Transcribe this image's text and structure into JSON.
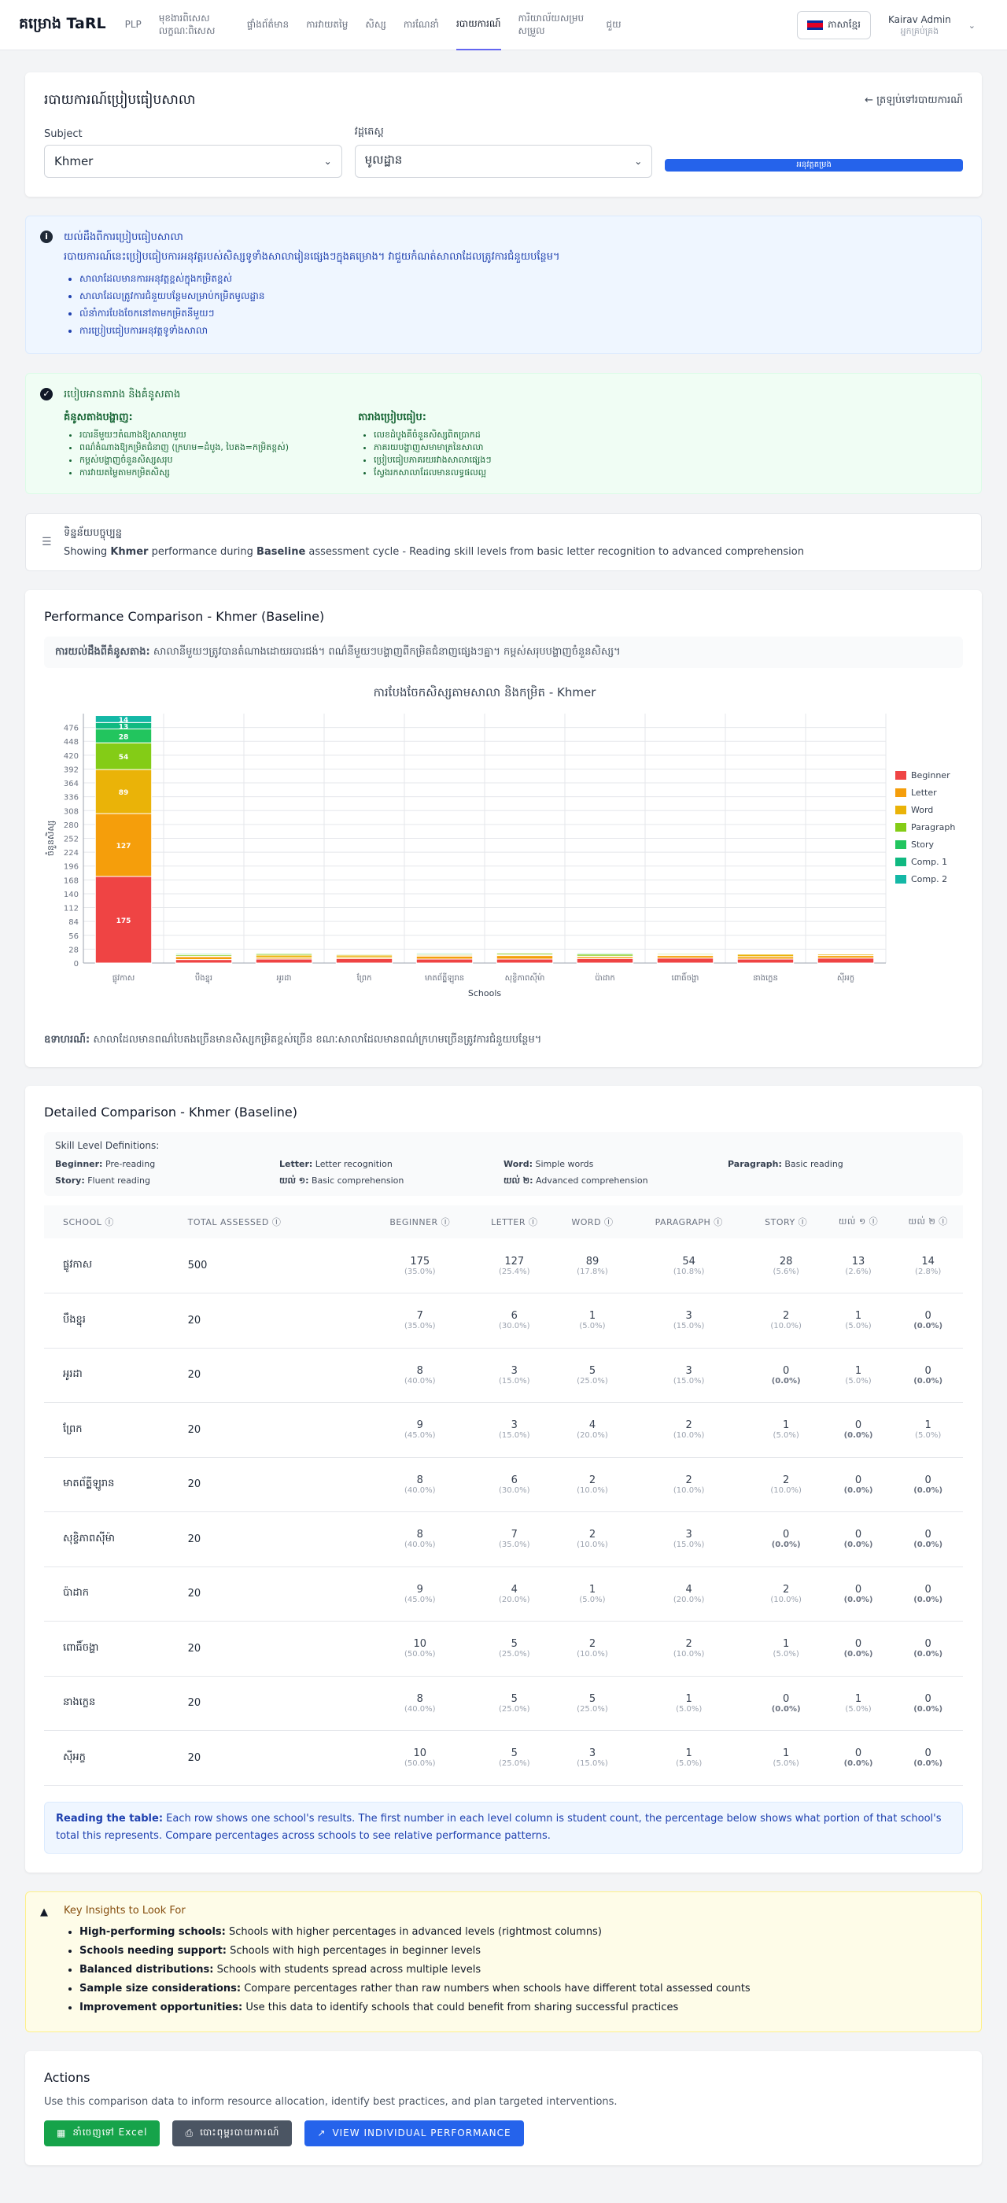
{
  "nav": {
    "brand": "គម្រោង TaRL",
    "links": [
      "PLP",
      "មុខងារពិសេស លក្ខណៈពិសេស",
      "ផ្ទាំងព័ត៌មាន",
      "ការវាយតម្លៃ",
      "សិស្ស",
      "ការណែនាំ",
      "របាយការណ៍",
      "ការិយាល័យសម្របសម្រួល",
      "ជួយ"
    ],
    "active_index": 6,
    "language": "ភាសាខ្មែរ",
    "user_name": "Kairav Admin",
    "user_role": "អ្នកគ្រប់គ្រង"
  },
  "filter": {
    "title": "របាយការណ៍ប្រៀបធៀបសាលា",
    "back_label": "← ត្រឡប់ទៅរបាយការណ៍",
    "subject_label": "Subject",
    "subject_value": "Khmer",
    "cycle_label": "វដ្តតេស្ត",
    "cycle_value": "មូលដ្ឋាន",
    "apply_label": "អនុវត្តតម្រង"
  },
  "info": {
    "title": "យល់ដឹងពីការប្រៀបធៀបសាលា",
    "desc": "របាយការណ៍នេះប្រៀបធៀបការអនុវត្តរបស់សិស្សទូទាំងសាលារៀនផ្សេងៗក្នុងគម្រោង។ វាជួយកំណត់សាលាដែលត្រូវការជំនួយបន្ថែម។",
    "items": [
      "សាលាដែលមានការអនុវត្តខ្ពស់ក្នុងកម្រិតខ្ពស់",
      "សាលាដែលត្រូវការជំនួយបន្ថែមសម្រាប់កម្រិតមូលដ្ឋាន",
      "លំនាំការបែងចែកនៅតាមកម្រិតនីមួយៗ",
      "ការប្រៀបធៀបការអនុវត្តទូទាំងសាលា"
    ]
  },
  "guide": {
    "title": "របៀបអានតារាង និងគំនូសតាង",
    "chart_heading": "គំនូសតាងបង្ហាញ:",
    "chart_items": [
      "របារនីមួយៗតំណាងឱ្យសាលាមួយ",
      "ពណ៌តំណាងឱ្យកម្រិតជំនាញ (ក្រហម=ដំបូង, បៃតង=កម្រិតខ្ពស់)",
      "កម្ពស់បង្ហាញចំនួនសិស្សសរុប",
      "ការវាយតម្លៃតាមកម្រិតសិស្ស"
    ],
    "table_heading": "តារាងប្រៀបធៀប:",
    "table_items": [
      "លេខដំបូងគឺចំនួនសិស្សពិតប្រាកដ",
      "ភាគរយបង្ហាញសមាមាត្រនៃសាលា",
      "ប្រៀបធៀបភាគរយរវាងសាលាផ្សេងៗ",
      "ស្វែងរកសាលាដែលមានលទ្ធផលល្អ"
    ]
  },
  "dataset": {
    "title": "ទិន្នន័យបច្ចុប្បន្ន",
    "prefix": "Showing",
    "subject": "Khmer",
    "mid": "performance during",
    "cycle": "Baseline",
    "suffix": "assessment cycle - Reading skill levels from basic letter recognition to advanced comprehension"
  },
  "performance": {
    "title": "Performance Comparison - Khmer (Baseline)",
    "note_label": "ការយល់ដឹងពីគំនូសតាង:",
    "note": "សាលានីមួយៗត្រូវបានតំណាងដោយរបារជង់។ ពណ៌នីមួយៗបង្ហាញពីកម្រិតជំនាញផ្សេងៗគ្នា។ កម្ពស់សរុបបង្ហាញចំនួនសិស្ស។",
    "example_label": "ឧទាហរណ៍:",
    "example": "សាលាដែលមានពណ៌បៃតងច្រើនមានសិស្សកម្រិតខ្ពស់ច្រើន ខណៈសាលាដែលមានពណ៌ក្រហមច្រើនត្រូវការជំនួយបន្ថែម។"
  },
  "chart_data": {
    "type": "bar",
    "stacked": true,
    "title": "ការបែងចែកសិស្សតាមសាលា និងកម្រិត - Khmer",
    "xlabel": "Schools",
    "ylabel": "ចំនួនសិស្ស",
    "ylim": [
      0,
      504
    ],
    "yticks": [
      0,
      28,
      56,
      84,
      112,
      140,
      168,
      196,
      224,
      252,
      280,
      308,
      336,
      364,
      392,
      420,
      448,
      476
    ],
    "categories": [
      "ផ្លូវកាស",
      "បឹងខ្នុរ",
      "អូរដា",
      "ព្រែក",
      "មាតព័ត្ត្ទីឡូរាន",
      "សុខ្ខិភាពស៊ីម៉ា",
      "ប៉ាដាក",
      "ពោធិ៍ចង្ហា",
      "នាងក្លេន",
      "ស៊ីអក្ខ"
    ],
    "legend_position": "right",
    "series": [
      {
        "name": "Beginner",
        "color": "#ef4444",
        "values": [
          175,
          7,
          8,
          9,
          8,
          8,
          9,
          10,
          8,
          10
        ]
      },
      {
        "name": "Letter",
        "color": "#f59e0b",
        "values": [
          127,
          6,
          3,
          3,
          6,
          7,
          4,
          5,
          5,
          5
        ]
      },
      {
        "name": "Word",
        "color": "#eab308",
        "values": [
          89,
          1,
          5,
          4,
          2,
          2,
          1,
          2,
          5,
          3
        ]
      },
      {
        "name": "Paragraph",
        "color": "#84cc16",
        "values": [
          54,
          3,
          3,
          2,
          2,
          3,
          4,
          2,
          1,
          1
        ]
      },
      {
        "name": "Story",
        "color": "#22c55e",
        "values": [
          28,
          2,
          0,
          1,
          2,
          0,
          2,
          1,
          0,
          1
        ]
      },
      {
        "name": "Comp. 1",
        "color": "#10b981",
        "values": [
          13,
          1,
          1,
          0,
          0,
          0,
          0,
          0,
          1,
          0
        ]
      },
      {
        "name": "Comp. 2",
        "color": "#14b8a6",
        "values": [
          14,
          0,
          0,
          1,
          0,
          0,
          0,
          0,
          0,
          0
        ]
      }
    ]
  },
  "detailed": {
    "title": "Detailed Comparison - Khmer (Baseline)",
    "defs_title": "Skill Level Definitions:",
    "defs": [
      {
        "k": "Beginner:",
        "v": "Pre-reading"
      },
      {
        "k": "Letter:",
        "v": "Letter recognition"
      },
      {
        "k": "Word:",
        "v": "Simple words"
      },
      {
        "k": "Paragraph:",
        "v": "Basic reading"
      },
      {
        "k": "Story:",
        "v": "Fluent reading"
      },
      {
        "k": "យល់ ១:",
        "v": "Basic comprehension"
      },
      {
        "k": "យល់ ២:",
        "v": "Advanced comprehension"
      }
    ],
    "headers": [
      "SCHOOL ⓘ",
      "TOTAL ASSESSED ⓘ",
      "BEGINNER ⓘ",
      "LETTER ⓘ",
      "WORD ⓘ",
      "PARAGRAPH ⓘ",
      "STORY ⓘ",
      "យល់ ១ ⓘ",
      "យល់ ២ ⓘ"
    ],
    "rows": [
      {
        "school": "ផ្លូវកាស",
        "total": "500",
        "cells": [
          [
            "175",
            "(35.0%)"
          ],
          [
            "127",
            "(25.4%)"
          ],
          [
            "89",
            "(17.8%)"
          ],
          [
            "54",
            "(10.8%)"
          ],
          [
            "28",
            "(5.6%)"
          ],
          [
            "13",
            "(2.6%)"
          ],
          [
            "14",
            "(2.8%)"
          ]
        ]
      },
      {
        "school": "បឹងខ្នុរ",
        "total": "20",
        "cells": [
          [
            "7",
            "(35.0%)"
          ],
          [
            "6",
            "(30.0%)"
          ],
          [
            "1",
            "(5.0%)"
          ],
          [
            "3",
            "(15.0%)"
          ],
          [
            "2",
            "(10.0%)"
          ],
          [
            "1",
            "(5.0%)"
          ],
          [
            "0",
            "(0.0%)"
          ]
        ]
      },
      {
        "school": "អូរដា",
        "total": "20",
        "cells": [
          [
            "8",
            "(40.0%)"
          ],
          [
            "3",
            "(15.0%)"
          ],
          [
            "5",
            "(25.0%)"
          ],
          [
            "3",
            "(15.0%)"
          ],
          [
            "0",
            "(0.0%)"
          ],
          [
            "1",
            "(5.0%)"
          ],
          [
            "0",
            "(0.0%)"
          ]
        ]
      },
      {
        "school": "ព្រែក",
        "total": "20",
        "cells": [
          [
            "9",
            "(45.0%)"
          ],
          [
            "3",
            "(15.0%)"
          ],
          [
            "4",
            "(20.0%)"
          ],
          [
            "2",
            "(10.0%)"
          ],
          [
            "1",
            "(5.0%)"
          ],
          [
            "0",
            "(0.0%)"
          ],
          [
            "1",
            "(5.0%)"
          ]
        ]
      },
      {
        "school": "មាតព័ត្ត្ទីឡូរាន",
        "total": "20",
        "cells": [
          [
            "8",
            "(40.0%)"
          ],
          [
            "6",
            "(30.0%)"
          ],
          [
            "2",
            "(10.0%)"
          ],
          [
            "2",
            "(10.0%)"
          ],
          [
            "2",
            "(10.0%)"
          ],
          [
            "0",
            "(0.0%)"
          ],
          [
            "0",
            "(0.0%)"
          ]
        ]
      },
      {
        "school": "សុខ្ខិភាពស៊ីម៉ា",
        "total": "20",
        "cells": [
          [
            "8",
            "(40.0%)"
          ],
          [
            "7",
            "(35.0%)"
          ],
          [
            "2",
            "(10.0%)"
          ],
          [
            "3",
            "(15.0%)"
          ],
          [
            "0",
            "(0.0%)"
          ],
          [
            "0",
            "(0.0%)"
          ],
          [
            "0",
            "(0.0%)"
          ]
        ]
      },
      {
        "school": "ប៉ាដាក",
        "total": "20",
        "cells": [
          [
            "9",
            "(45.0%)"
          ],
          [
            "4",
            "(20.0%)"
          ],
          [
            "1",
            "(5.0%)"
          ],
          [
            "4",
            "(20.0%)"
          ],
          [
            "2",
            "(10.0%)"
          ],
          [
            "0",
            "(0.0%)"
          ],
          [
            "0",
            "(0.0%)"
          ]
        ]
      },
      {
        "school": "ពោធិ៍ចង្ហា",
        "total": "20",
        "cells": [
          [
            "10",
            "(50.0%)"
          ],
          [
            "5",
            "(25.0%)"
          ],
          [
            "2",
            "(10.0%)"
          ],
          [
            "2",
            "(10.0%)"
          ],
          [
            "1",
            "(5.0%)"
          ],
          [
            "0",
            "(0.0%)"
          ],
          [
            "0",
            "(0.0%)"
          ]
        ]
      },
      {
        "school": "នាងក្លេន",
        "total": "20",
        "cells": [
          [
            "8",
            "(40.0%)"
          ],
          [
            "5",
            "(25.0%)"
          ],
          [
            "5",
            "(25.0%)"
          ],
          [
            "1",
            "(5.0%)"
          ],
          [
            "0",
            "(0.0%)"
          ],
          [
            "1",
            "(5.0%)"
          ],
          [
            "0",
            "(0.0%)"
          ]
        ]
      },
      {
        "school": "ស៊ីអក្ខ",
        "total": "20",
        "cells": [
          [
            "10",
            "(50.0%)"
          ],
          [
            "5",
            "(25.0%)"
          ],
          [
            "3",
            "(15.0%)"
          ],
          [
            "1",
            "(5.0%)"
          ],
          [
            "1",
            "(5.0%)"
          ],
          [
            "0",
            "(0.0%)"
          ],
          [
            "0",
            "(0.0%)"
          ]
        ]
      }
    ],
    "reading_label": "Reading the table:",
    "reading": "Each row shows one school's results. The first number in each level column is student count, the percentage below shows what portion of that school's total this represents. Compare percentages across schools to see relative performance patterns."
  },
  "insights": {
    "title": "Key Insights to Look For",
    "items": [
      {
        "k": "High-performing schools:",
        "v": "Schools with higher percentages in advanced levels (rightmost columns)"
      },
      {
        "k": "Schools needing support:",
        "v": "Schools with high percentages in beginner levels"
      },
      {
        "k": "Balanced distributions:",
        "v": "Schools with students spread across multiple levels"
      },
      {
        "k": "Sample size considerations:",
        "v": "Compare percentages rather than raw numbers when schools have different total assessed counts"
      },
      {
        "k": "Improvement opportunities:",
        "v": "Use this data to identify schools that could benefit from sharing successful practices"
      }
    ]
  },
  "actions": {
    "title": "Actions",
    "desc": "Use this comparison data to inform resource allocation, identify best practices, and plan targeted interventions.",
    "export_label": "នាំចេញទៅ Excel",
    "print_label": "បោះពុម្ពរបាយការណ៍",
    "view_label": "VIEW INDIVIDUAL PERFORMANCE"
  }
}
